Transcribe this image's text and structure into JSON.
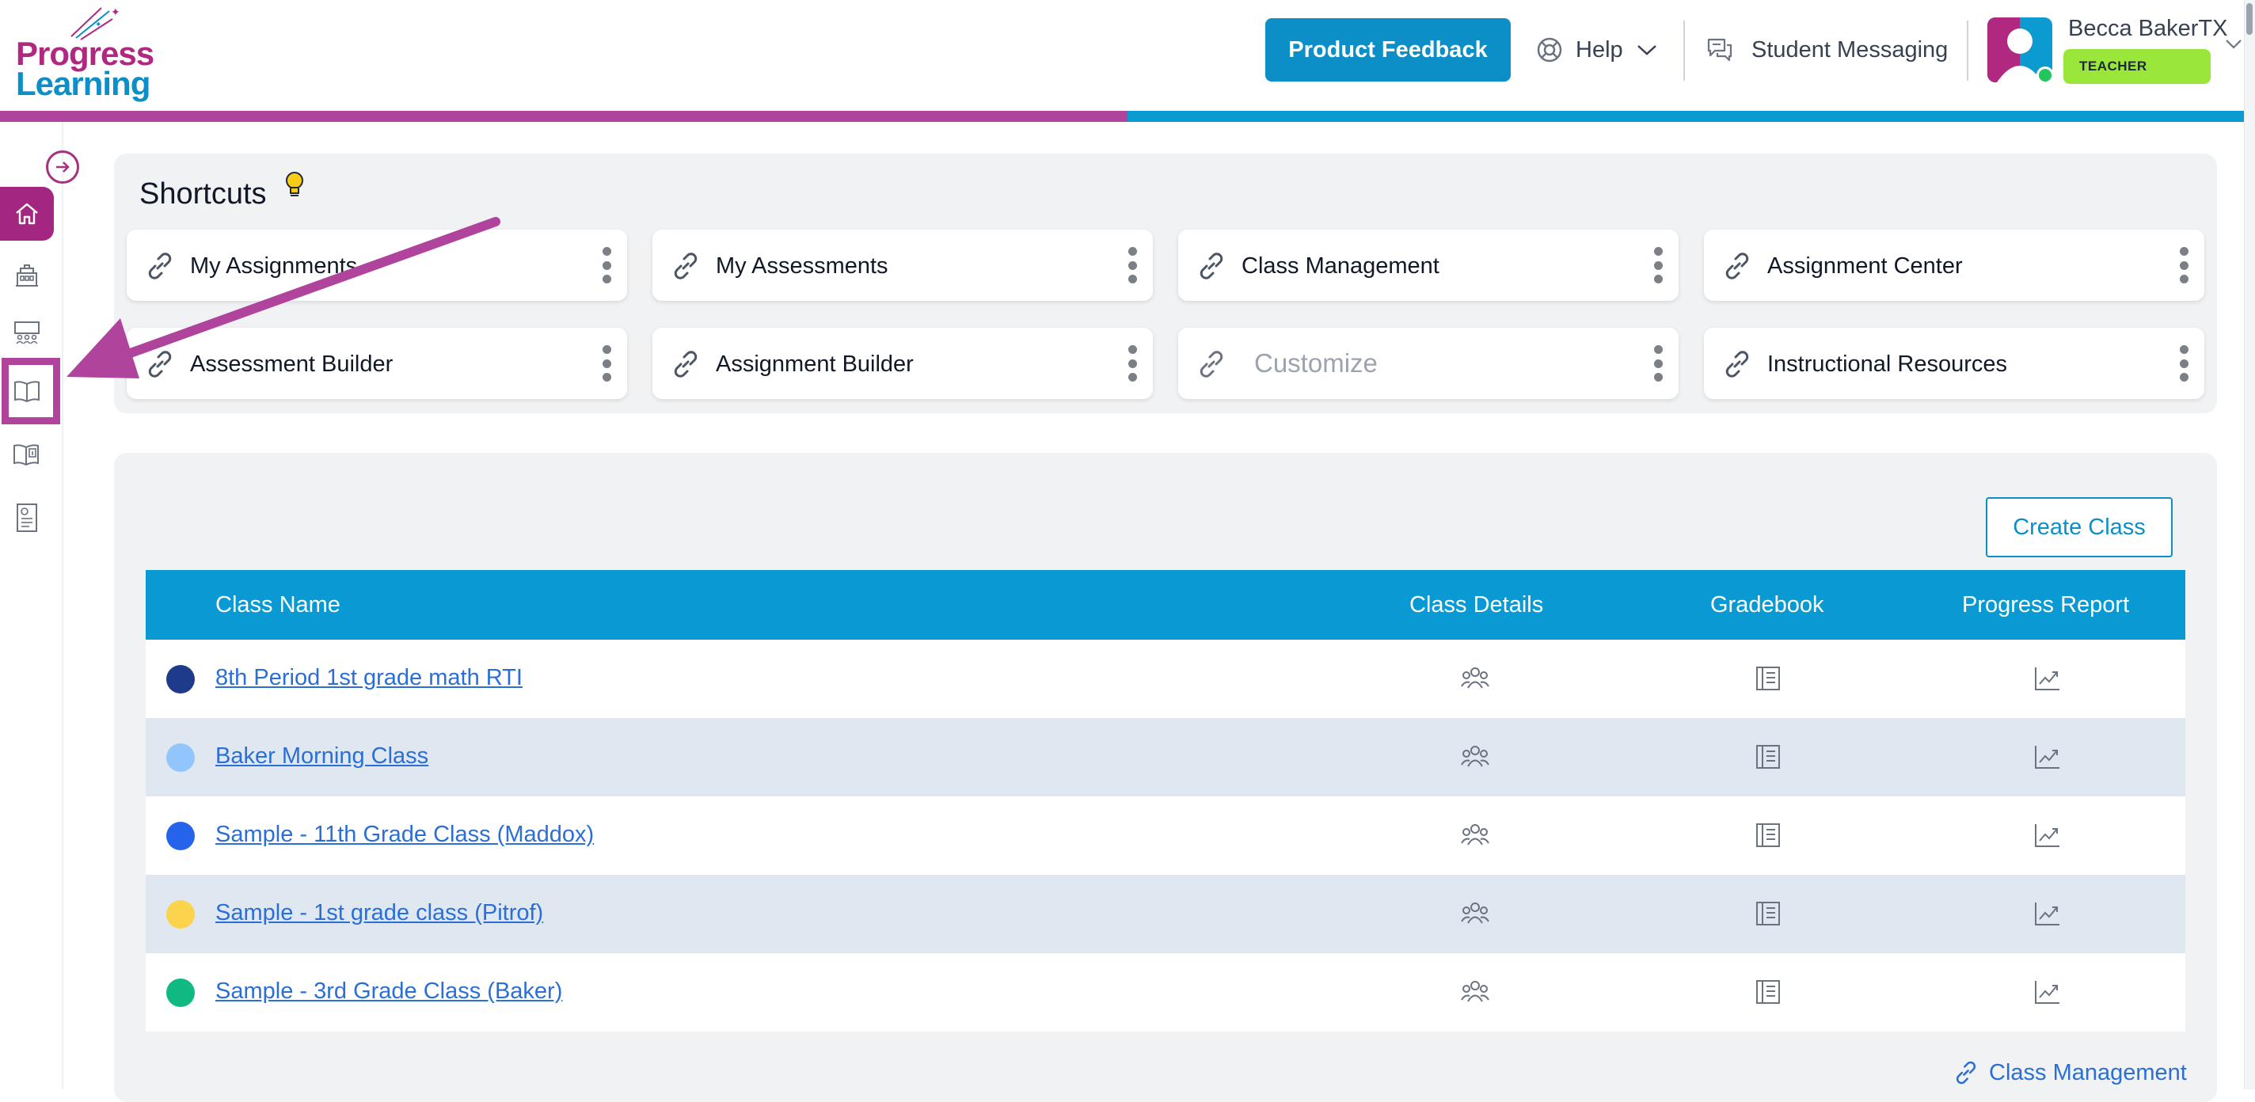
{
  "brand": {
    "logo_line1": "Progress",
    "logo_line2": "Learning",
    "primary": "#b0287f",
    "secondary": "#0c8fc6"
  },
  "header": {
    "feedback_label": "Product Feedback",
    "help_label": "Help",
    "messaging_label": "Student Messaging",
    "user_name": "Becca BakerTX",
    "user_role": "TEACHER"
  },
  "sidebar": {
    "items": [
      {
        "icon": "home-icon",
        "active": true
      },
      {
        "icon": "school-building-icon",
        "active": false
      },
      {
        "icon": "classroom-icon",
        "active": false
      },
      {
        "icon": "open-book-icon",
        "active": false
      },
      {
        "icon": "book-info-icon",
        "active": false
      },
      {
        "icon": "certificate-document-icon",
        "active": false
      }
    ]
  },
  "shortcuts": {
    "title": "Shortcuts",
    "items": [
      {
        "label": "My Assignments"
      },
      {
        "label": "My Assessments"
      },
      {
        "label": "Class Management"
      },
      {
        "label": "Assignment Center"
      },
      {
        "label": "Assessment Builder"
      },
      {
        "label": "Assignment Builder"
      },
      {
        "label": "Customize"
      },
      {
        "label": "Instructional Resources"
      }
    ]
  },
  "classes": {
    "create_label": "Create Class",
    "columns": [
      "Class Name",
      "Class Details",
      "Gradebook",
      "Progress Report"
    ],
    "rows": [
      {
        "name": "8th Period 1st grade math RTI",
        "color": "#1e3a8a"
      },
      {
        "name": "Baker Morning Class",
        "color": "#93c5fd"
      },
      {
        "name": "Sample - 11th Grade Class (Maddox)",
        "color": "#2563eb"
      },
      {
        "name": "Sample - 1st grade class (Pitrof)",
        "color": "#fcd34d"
      },
      {
        "name": "Sample - 3rd Grade Class (Baker)",
        "color": "#10b981"
      }
    ],
    "footer_link": "Class Management"
  },
  "annotation": {
    "color": "#b0449c"
  }
}
